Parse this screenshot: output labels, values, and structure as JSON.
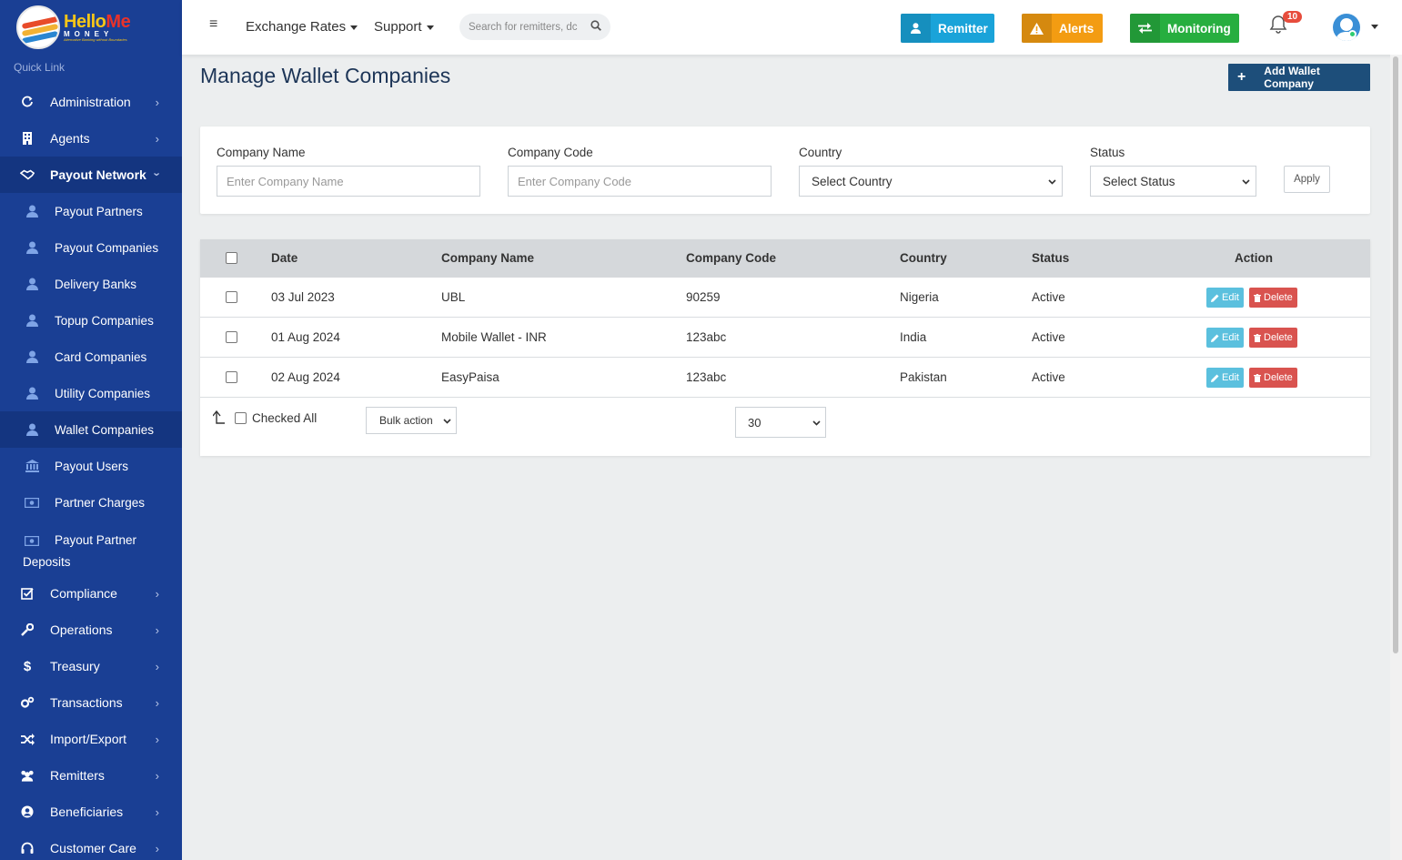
{
  "brand": {
    "word_hello": "Hello",
    "word_me": "Me",
    "word_money": "MONEY",
    "tagline": "Alternative Banking without Boundaries"
  },
  "sidebar": {
    "quick_link": "Quick Link",
    "items": [
      {
        "label": "Administration",
        "icon": "refresh-icon"
      },
      {
        "label": "Agents",
        "icon": "building-icon"
      },
      {
        "label": "Payout Network",
        "icon": "handshake-icon"
      },
      {
        "label": "Compliance",
        "icon": "checkbox-icon"
      },
      {
        "label": "Operations",
        "icon": "wrench-icon"
      },
      {
        "label": "Treasury",
        "icon": "dollar-icon"
      },
      {
        "label": "Transactions",
        "icon": "cogs-icon"
      },
      {
        "label": "Import/Export",
        "icon": "shuffle-icon"
      },
      {
        "label": "Remitters",
        "icon": "users-icon"
      },
      {
        "label": "Beneficiaries",
        "icon": "user-circle-icon"
      },
      {
        "label": "Customer Care",
        "icon": "headset-icon"
      }
    ],
    "sub_items": [
      {
        "label": "Payout Partners"
      },
      {
        "label": "Payout Companies"
      },
      {
        "label": "Delivery Banks"
      },
      {
        "label": "Topup Companies"
      },
      {
        "label": "Card Companies"
      },
      {
        "label": "Utility Companies"
      },
      {
        "label": "Wallet Companies"
      },
      {
        "label": "Payout Users"
      },
      {
        "label": "Partner Charges"
      },
      {
        "label_line1": "Payout Partner",
        "label_line2": "Deposits"
      }
    ]
  },
  "topbar": {
    "exchange_rates": "Exchange Rates",
    "support": "Support",
    "search_placeholder": "Search for remitters, dc",
    "remitter_btn": "Remitter",
    "alerts_btn": "Alerts",
    "monitoring_btn": "Monitoring",
    "notification_count": "10",
    "colors": {
      "remitter": "#1aa3d9",
      "alerts": "#f39c12",
      "monitoring": "#27ae3f"
    }
  },
  "page": {
    "title": "Manage Wallet Companies",
    "add_button": "Add Wallet Company"
  },
  "filters": {
    "company_name_label": "Company Name",
    "company_name_placeholder": "Enter Company Name",
    "company_code_label": "Company Code",
    "company_code_placeholder": "Enter Company Code",
    "country_label": "Country",
    "country_value": "Select Country",
    "status_label": "Status",
    "status_value": "Select Status",
    "apply": "Apply"
  },
  "table": {
    "headers": [
      "Date",
      "Company Name",
      "Company Code",
      "Country",
      "Status",
      "Action"
    ],
    "rows": [
      {
        "date": "03 Jul 2023",
        "name": "UBL",
        "code": "90259",
        "country": "Nigeria",
        "status": "Active"
      },
      {
        "date": "01 Aug 2024",
        "name": "Mobile Wallet - INR",
        "code": "123abc",
        "country": "India",
        "status": "Active"
      },
      {
        "date": "02 Aug 2024",
        "name": "EasyPaisa",
        "code": "123abc",
        "country": "Pakistan",
        "status": "Active"
      }
    ],
    "edit_label": "Edit",
    "delete_label": "Delete",
    "checked_all": "Checked All",
    "bulk_action": "Bulk action",
    "page_size": "30"
  }
}
